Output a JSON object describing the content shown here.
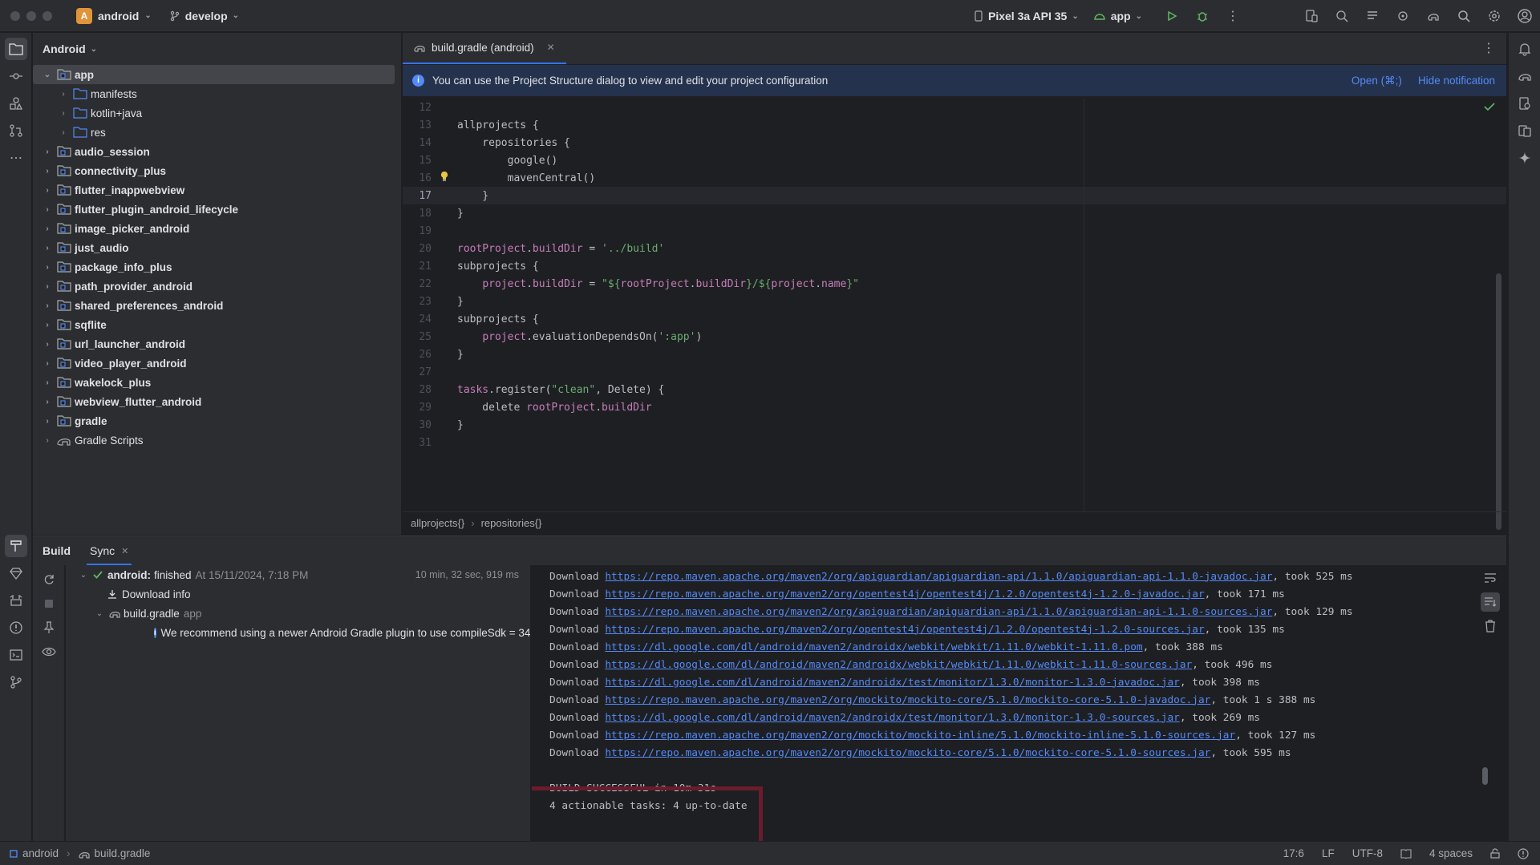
{
  "titlebar": {
    "project_initial": "A",
    "project_name": "android",
    "branch": "develop",
    "device": "Pixel 3a API 35",
    "run_config": "app"
  },
  "project_panel": {
    "view_mode": "Android",
    "tree": [
      {
        "label": "app",
        "level": 0,
        "expanded": true,
        "selected": true,
        "kind": "module"
      },
      {
        "label": "manifests",
        "level": 1,
        "kind": "folder"
      },
      {
        "label": "kotlin+java",
        "level": 1,
        "kind": "folder"
      },
      {
        "label": "res",
        "level": 1,
        "kind": "folder"
      },
      {
        "label": "audio_session",
        "level": 0,
        "kind": "module"
      },
      {
        "label": "connectivity_plus",
        "level": 0,
        "kind": "module"
      },
      {
        "label": "flutter_inappwebview",
        "level": 0,
        "kind": "module"
      },
      {
        "label": "flutter_plugin_android_lifecycle",
        "level": 0,
        "kind": "module"
      },
      {
        "label": "image_picker_android",
        "level": 0,
        "kind": "module"
      },
      {
        "label": "just_audio",
        "level": 0,
        "kind": "module"
      },
      {
        "label": "package_info_plus",
        "level": 0,
        "kind": "module"
      },
      {
        "label": "path_provider_android",
        "level": 0,
        "kind": "module"
      },
      {
        "label": "shared_preferences_android",
        "level": 0,
        "kind": "module"
      },
      {
        "label": "sqflite",
        "level": 0,
        "kind": "module"
      },
      {
        "label": "url_launcher_android",
        "level": 0,
        "kind": "module"
      },
      {
        "label": "video_player_android",
        "level": 0,
        "kind": "module"
      },
      {
        "label": "wakelock_plus",
        "level": 0,
        "kind": "module"
      },
      {
        "label": "webview_flutter_android",
        "level": 0,
        "kind": "module"
      },
      {
        "label": "gradle",
        "level": 0,
        "kind": "module"
      },
      {
        "label": "Gradle Scripts",
        "level": 0,
        "kind": "gradle"
      }
    ]
  },
  "editor": {
    "tab_label": "build.gradle (android)",
    "notification": {
      "text": "You can use the Project Structure dialog to view and edit your project configuration",
      "open_link": "Open (⌘;)",
      "hide_link": "Hide notification"
    },
    "current_line": 17,
    "lines": [
      {
        "n": "12",
        "tokens": []
      },
      {
        "n": "13",
        "tokens": [
          {
            "t": "allprojects {",
            "c": "ct"
          }
        ]
      },
      {
        "n": "14",
        "tokens": [
          {
            "t": "    repositories {",
            "c": "ct"
          }
        ]
      },
      {
        "n": "15",
        "tokens": [
          {
            "t": "        google()",
            "c": "ct"
          }
        ]
      },
      {
        "n": "16",
        "tokens": [
          {
            "t": "        mavenCentral()",
            "c": "ct"
          }
        ]
      },
      {
        "n": "17",
        "tokens": [
          {
            "t": "    }",
            "c": "ct"
          }
        ]
      },
      {
        "n": "18",
        "tokens": [
          {
            "t": "}",
            "c": "ct"
          }
        ]
      },
      {
        "n": "19",
        "tokens": []
      },
      {
        "n": "20",
        "tokens": [
          {
            "t": "rootProject",
            "c": "pr"
          },
          {
            "t": ".",
            "c": "ct"
          },
          {
            "t": "buildDir",
            "c": "pr"
          },
          {
            "t": " = ",
            "c": "ct"
          },
          {
            "t": "'../build'",
            "c": "st"
          }
        ]
      },
      {
        "n": "21",
        "tokens": [
          {
            "t": "subprojects {",
            "c": "ct"
          }
        ]
      },
      {
        "n": "22",
        "tokens": [
          {
            "t": "    ",
            "c": "ct"
          },
          {
            "t": "project",
            "c": "pr"
          },
          {
            "t": ".",
            "c": "ct"
          },
          {
            "t": "buildDir",
            "c": "pr"
          },
          {
            "t": " = ",
            "c": "ct"
          },
          {
            "t": "\"${",
            "c": "st"
          },
          {
            "t": "rootProject",
            "c": "pr"
          },
          {
            "t": ".",
            "c": "ct"
          },
          {
            "t": "buildDir",
            "c": "pr"
          },
          {
            "t": "}/${",
            "c": "st"
          },
          {
            "t": "project",
            "c": "pr"
          },
          {
            "t": ".",
            "c": "ct"
          },
          {
            "t": "name",
            "c": "pr"
          },
          {
            "t": "}\"",
            "c": "st"
          }
        ]
      },
      {
        "n": "23",
        "tokens": [
          {
            "t": "}",
            "c": "ct"
          }
        ]
      },
      {
        "n": "24",
        "tokens": [
          {
            "t": "subprojects {",
            "c": "ct"
          }
        ]
      },
      {
        "n": "25",
        "tokens": [
          {
            "t": "    ",
            "c": "ct"
          },
          {
            "t": "project",
            "c": "pr"
          },
          {
            "t": ".evaluationDependsOn(",
            "c": "ct"
          },
          {
            "t": "':app'",
            "c": "st"
          },
          {
            "t": ")",
            "c": "ct"
          }
        ]
      },
      {
        "n": "26",
        "tokens": [
          {
            "t": "}",
            "c": "ct"
          }
        ]
      },
      {
        "n": "27",
        "tokens": []
      },
      {
        "n": "28",
        "tokens": [
          {
            "t": "tasks",
            "c": "pr"
          },
          {
            "t": ".register(",
            "c": "ct"
          },
          {
            "t": "\"clean\"",
            "c": "st"
          },
          {
            "t": ", Delete) {",
            "c": "ct"
          }
        ]
      },
      {
        "n": "29",
        "tokens": [
          {
            "t": "    delete ",
            "c": "ct"
          },
          {
            "t": "rootProject",
            "c": "pr"
          },
          {
            "t": ".",
            "c": "ct"
          },
          {
            "t": "buildDir",
            "c": "pr"
          }
        ]
      },
      {
        "n": "30",
        "tokens": [
          {
            "t": "}",
            "c": "ct"
          }
        ]
      },
      {
        "n": "31",
        "tokens": []
      }
    ],
    "breadcrumbs": [
      "allprojects{}",
      "repositories{}"
    ]
  },
  "build_panel": {
    "tabs": [
      {
        "label": "Build"
      },
      {
        "label": "Sync"
      }
    ],
    "tree": {
      "root_label": "android:",
      "root_status": "finished",
      "root_time": "At 15/11/2024, 7:18 PM",
      "root_duration": "10 min, 32 sec, 919 ms",
      "download_info": "Download info",
      "gradle_file": "build.gradle",
      "gradle_module": "app",
      "recommendation": "We recommend using a newer Android Gradle plugin to use compileSdk = 34"
    },
    "console": [
      {
        "prefix": "Download ",
        "url": "https://repo.maven.apache.org/maven2/org/apiguardian/apiguardian-api/1.1.0/apiguardian-api-1.1.0-javadoc.jar",
        "suffix": ", took 525 ms"
      },
      {
        "prefix": "Download ",
        "url": "https://repo.maven.apache.org/maven2/org/opentest4j/opentest4j/1.2.0/opentest4j-1.2.0-javadoc.jar",
        "suffix": ", took 171 ms"
      },
      {
        "prefix": "Download ",
        "url": "https://repo.maven.apache.org/maven2/org/apiguardian/apiguardian-api/1.1.0/apiguardian-api-1.1.0-sources.jar",
        "suffix": ", took 129 ms"
      },
      {
        "prefix": "Download ",
        "url": "https://repo.maven.apache.org/maven2/org/opentest4j/opentest4j/1.2.0/opentest4j-1.2.0-sources.jar",
        "suffix": ", took 135 ms"
      },
      {
        "prefix": "Download ",
        "url": "https://dl.google.com/dl/android/maven2/androidx/webkit/webkit/1.11.0/webkit-1.11.0.pom",
        "suffix": ", took 388 ms"
      },
      {
        "prefix": "Download ",
        "url": "https://dl.google.com/dl/android/maven2/androidx/webkit/webkit/1.11.0/webkit-1.11.0-sources.jar",
        "suffix": ", took 496 ms"
      },
      {
        "prefix": "Download ",
        "url": "https://dl.google.com/dl/android/maven2/androidx/test/monitor/1.3.0/monitor-1.3.0-javadoc.jar",
        "suffix": ", took 398 ms"
      },
      {
        "prefix": "Download ",
        "url": "https://repo.maven.apache.org/maven2/org/mockito/mockito-core/5.1.0/mockito-core-5.1.0-javadoc.jar",
        "suffix": ", took 1 s 388 ms"
      },
      {
        "prefix": "Download ",
        "url": "https://dl.google.com/dl/android/maven2/androidx/test/monitor/1.3.0/monitor-1.3.0-sources.jar",
        "suffix": ", took 269 ms"
      },
      {
        "prefix": "Download ",
        "url": "https://repo.maven.apache.org/maven2/org/mockito/mockito-inline/5.1.0/mockito-inline-5.1.0-sources.jar",
        "suffix": ", took 127 ms"
      },
      {
        "prefix": "Download ",
        "url": "https://repo.maven.apache.org/maven2/org/mockito/mockito-core/5.1.0/mockito-core-5.1.0-sources.jar",
        "suffix": ", took 595 ms"
      },
      {
        "prefix": "",
        "url": "",
        "suffix": ""
      },
      {
        "prefix": "BUILD SUCCESSFUL in 10m 31s",
        "url": "",
        "suffix": ""
      },
      {
        "prefix": "4 actionable tasks: 4 up-to-date",
        "url": "",
        "suffix": ""
      }
    ]
  },
  "statusbar": {
    "crumb_project": "android",
    "crumb_file": "build.gradle",
    "position": "17:6",
    "line_ending": "LF",
    "encoding": "UTF-8",
    "indent": "4 spaces"
  },
  "colors": {
    "accent": "#3574f0",
    "link": "#548af7",
    "success": "#5fb865",
    "highlight_box": "#6b1c2c",
    "run_green": "#5fb865"
  }
}
